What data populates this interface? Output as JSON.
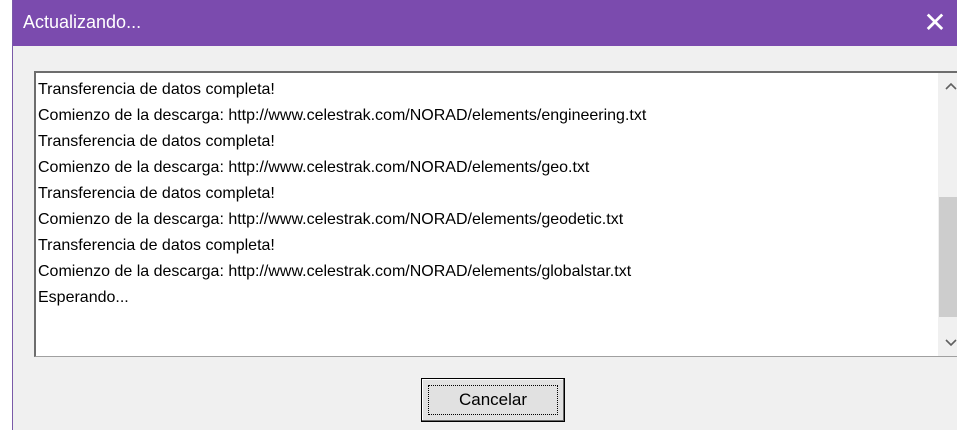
{
  "window": {
    "title": "Actualizando...",
    "close_glyph": "✕",
    "accent": "#7b4bae"
  },
  "log": {
    "lines": [
      "Transferencia de datos completa!",
      "Comienzo de la descarga: http://www.celestrak.com/NORAD/elements/engineering.txt",
      "Transferencia de datos completa!",
      "Comienzo de la descarga: http://www.celestrak.com/NORAD/elements/geo.txt",
      "Transferencia de datos completa!",
      "Comienzo de la descarga: http://www.celestrak.com/NORAD/elements/geodetic.txt",
      "Transferencia de datos completa!",
      "Comienzo de la descarga: http://www.celestrak.com/NORAD/elements/globalstar.txt",
      "Esperando..."
    ]
  },
  "buttons": {
    "cancel_label": "Cancelar"
  },
  "icons": {
    "close": "close-icon",
    "scroll_up": "chevron-up-icon",
    "scroll_down": "chevron-down-icon"
  }
}
